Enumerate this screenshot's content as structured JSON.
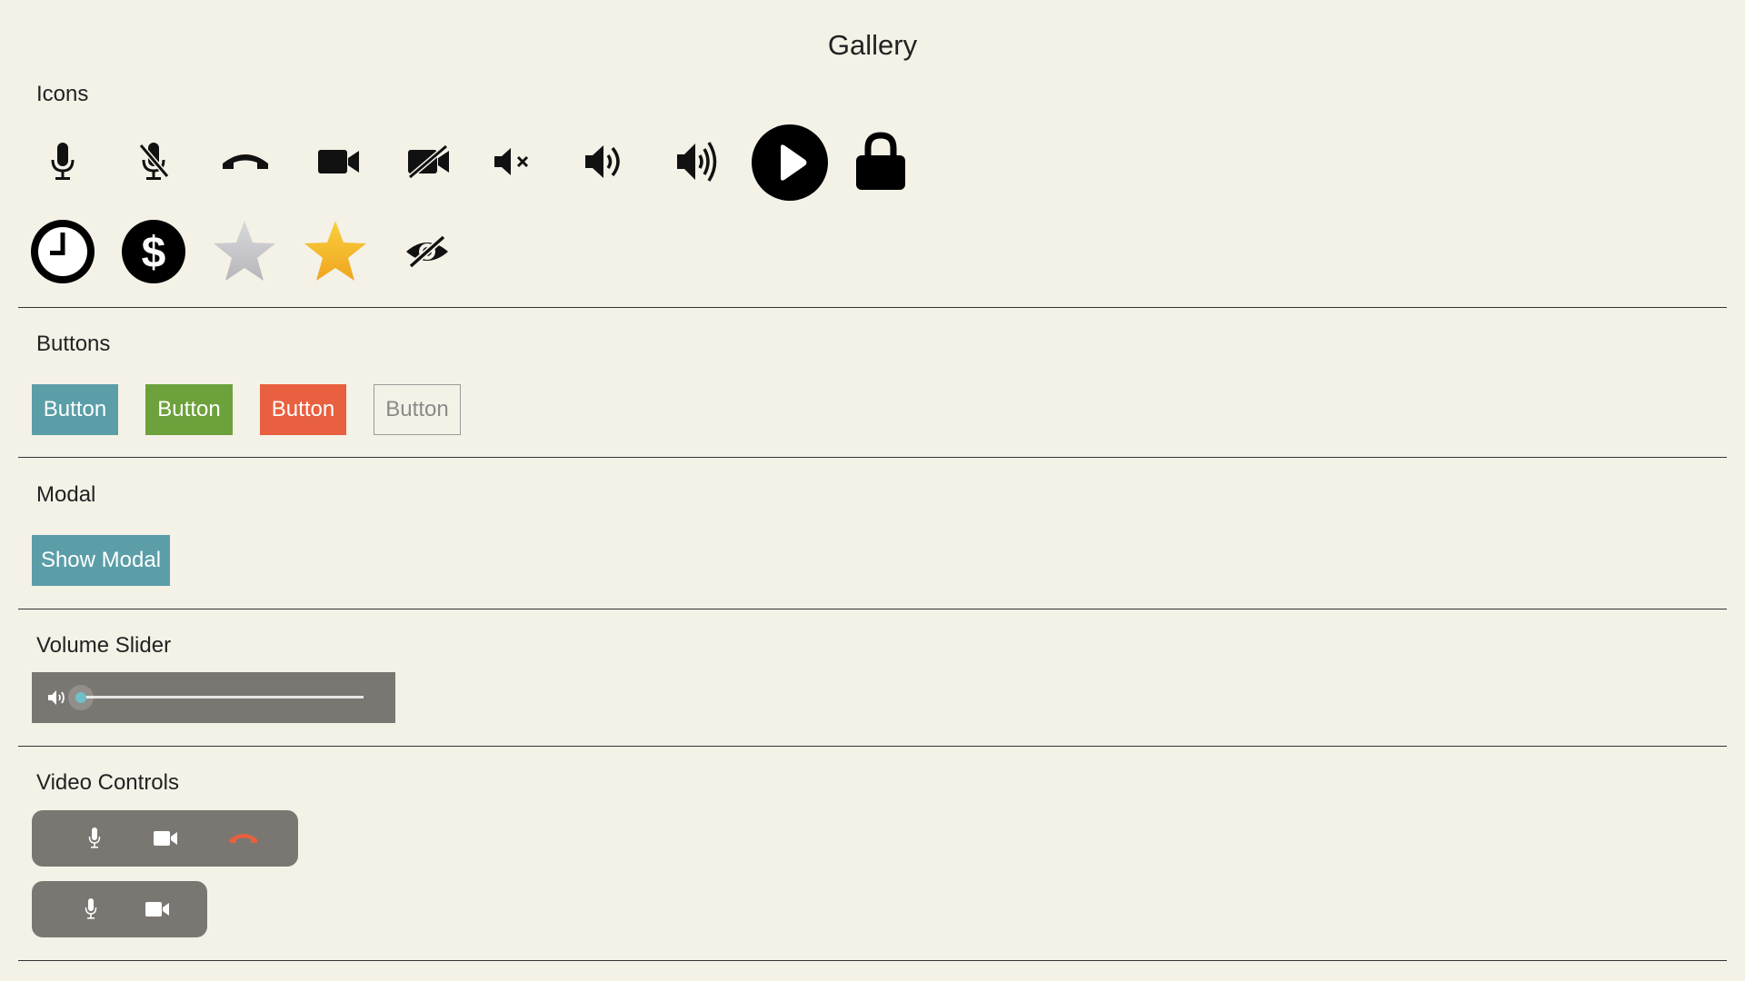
{
  "page": {
    "title": "Gallery"
  },
  "sections": {
    "icons": {
      "heading": "Icons"
    },
    "buttons": {
      "heading": "Buttons",
      "items": [
        {
          "label": "Button",
          "variant": "primary",
          "color": "#5b9ea8"
        },
        {
          "label": "Button",
          "variant": "success",
          "color": "#6da13b"
        },
        {
          "label": "Button",
          "variant": "danger",
          "color": "#e8603f"
        },
        {
          "label": "Button",
          "variant": "outline",
          "color": "#9a9a9a"
        }
      ]
    },
    "modal": {
      "heading": "Modal",
      "button_label": "Show Modal"
    },
    "volume_slider": {
      "heading": "Volume Slider",
      "value_fraction": 0.0,
      "accent": "#6fc0c8"
    },
    "video_controls": {
      "heading": "Video Controls"
    }
  },
  "icons": [
    "microphone-icon",
    "microphone-off-icon",
    "phone-hangup-icon",
    "video-camera-icon",
    "video-camera-off-icon",
    "volume-mute-icon",
    "volume-medium-icon",
    "volume-high-icon",
    "play-icon",
    "lock-icon",
    "clock-icon",
    "dollar-icon",
    "star-empty-icon",
    "star-filled-icon",
    "eye-off-icon"
  ],
  "colors": {
    "background": "#f4f1e7",
    "star_gold": "#f5b82e",
    "star_gray": "#c8c8cc",
    "hangup_red": "#e8603f",
    "control_bar": "#7a7772"
  }
}
